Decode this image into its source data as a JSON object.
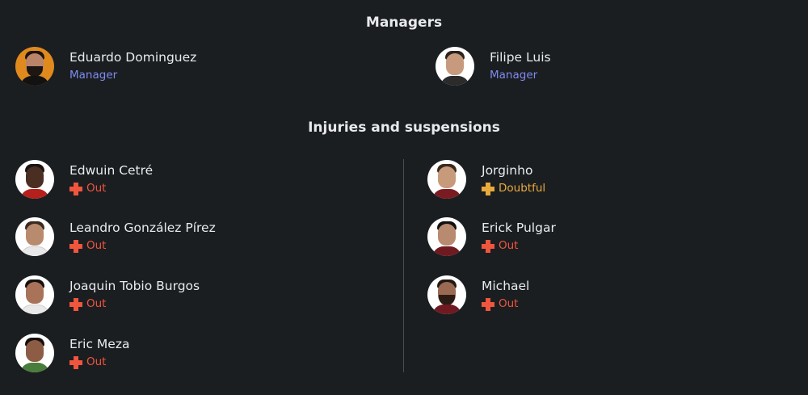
{
  "managers": {
    "title": "Managers",
    "items": [
      {
        "name": "Eduardo Dominguez",
        "role": "Manager"
      },
      {
        "name": "Filipe Luis",
        "role": "Manager"
      }
    ]
  },
  "injuries": {
    "title": "Injuries and suspensions",
    "left": [
      {
        "name": "Edwuin Cetré",
        "status": "Out"
      },
      {
        "name": "Leandro González Pírez",
        "status": "Out"
      },
      {
        "name": "Joaquin Tobio Burgos",
        "status": "Out"
      },
      {
        "name": "Eric Meza",
        "status": "Out"
      }
    ],
    "right": [
      {
        "name": "Jorginho",
        "status": "Doubtful"
      },
      {
        "name": "Erick Pulgar",
        "status": "Out"
      },
      {
        "name": "Michael",
        "status": "Out"
      }
    ]
  },
  "colors": {
    "background": "#1b1e21",
    "manager_role": "#7d8bf0",
    "out": "#f0553d",
    "doubtful": "#e9a93c",
    "divider": "#4a4e53"
  },
  "icons": {
    "out": "cross-icon",
    "doubtful": "cross-icon"
  }
}
